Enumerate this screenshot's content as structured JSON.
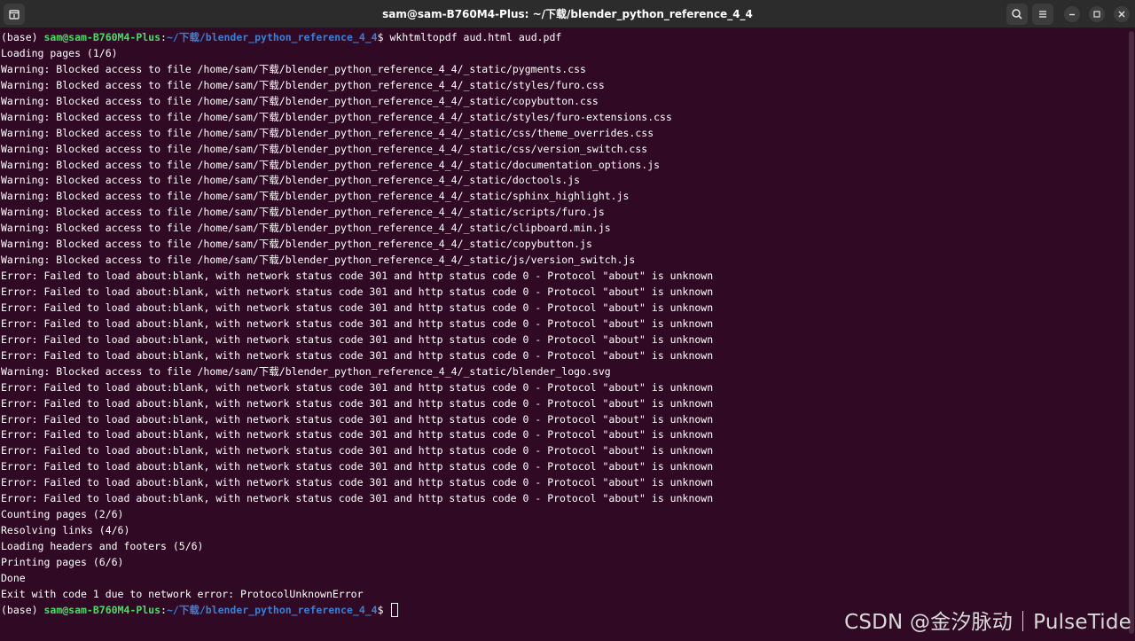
{
  "window": {
    "title": "sam@sam-B760M4-Plus: ~/下载/blender_python_reference_4_4",
    "icons": [
      "new-tab-icon",
      "search-icon",
      "menu-icon",
      "minimize-icon",
      "restore-icon",
      "close-icon"
    ]
  },
  "prompt": {
    "env": "(base) ",
    "user_host": "sam@sam-B760M4-Plus",
    "sep": ":",
    "path": "~/下载/blender_python_reference_4_4",
    "sign": "$ "
  },
  "command": "wkhtmltopdf aud.html aud.pdf",
  "output": [
    "Loading pages (1/6)",
    "Warning: Blocked access to file /home/sam/下载/blender_python_reference_4_4/_static/pygments.css",
    "Warning: Blocked access to file /home/sam/下载/blender_python_reference_4_4/_static/styles/furo.css",
    "Warning: Blocked access to file /home/sam/下载/blender_python_reference_4_4/_static/copybutton.css",
    "Warning: Blocked access to file /home/sam/下载/blender_python_reference_4_4/_static/styles/furo-extensions.css",
    "Warning: Blocked access to file /home/sam/下载/blender_python_reference_4_4/_static/css/theme_overrides.css",
    "Warning: Blocked access to file /home/sam/下载/blender_python_reference_4_4/_static/css/version_switch.css",
    "Warning: Blocked access to file /home/sam/下载/blender_python_reference_4_4/_static/documentation_options.js",
    "Warning: Blocked access to file /home/sam/下载/blender_python_reference_4_4/_static/doctools.js",
    "Warning: Blocked access to file /home/sam/下载/blender_python_reference_4_4/_static/sphinx_highlight.js",
    "Warning: Blocked access to file /home/sam/下载/blender_python_reference_4_4/_static/scripts/furo.js",
    "Warning: Blocked access to file /home/sam/下载/blender_python_reference_4_4/_static/clipboard.min.js",
    "Warning: Blocked access to file /home/sam/下载/blender_python_reference_4_4/_static/copybutton.js",
    "Warning: Blocked access to file /home/sam/下载/blender_python_reference_4_4/_static/js/version_switch.js",
    "Error: Failed to load about:blank, with network status code 301 and http status code 0 - Protocol \"about\" is unknown",
    "Error: Failed to load about:blank, with network status code 301 and http status code 0 - Protocol \"about\" is unknown",
    "Error: Failed to load about:blank, with network status code 301 and http status code 0 - Protocol \"about\" is unknown",
    "Error: Failed to load about:blank, with network status code 301 and http status code 0 - Protocol \"about\" is unknown",
    "Error: Failed to load about:blank, with network status code 301 and http status code 0 - Protocol \"about\" is unknown",
    "Error: Failed to load about:blank, with network status code 301 and http status code 0 - Protocol \"about\" is unknown",
    "Warning: Blocked access to file /home/sam/下载/blender_python_reference_4_4/_static/blender_logo.svg",
    "Error: Failed to load about:blank, with network status code 301 and http status code 0 - Protocol \"about\" is unknown",
    "Error: Failed to load about:blank, with network status code 301 and http status code 0 - Protocol \"about\" is unknown",
    "Error: Failed to load about:blank, with network status code 301 and http status code 0 - Protocol \"about\" is unknown",
    "Error: Failed to load about:blank, with network status code 301 and http status code 0 - Protocol \"about\" is unknown",
    "Error: Failed to load about:blank, with network status code 301 and http status code 0 - Protocol \"about\" is unknown",
    "Error: Failed to load about:blank, with network status code 301 and http status code 0 - Protocol \"about\" is unknown",
    "Error: Failed to load about:blank, with network status code 301 and http status code 0 - Protocol \"about\" is unknown",
    "Error: Failed to load about:blank, with network status code 301 and http status code 0 - Protocol \"about\" is unknown",
    "Counting pages (2/6)",
    "Resolving links (4/6)",
    "Loading headers and footers (5/6)",
    "Printing pages (6/6)",
    "Done",
    "Exit with code 1 due to network error: ProtocolUnknownError"
  ],
  "watermark": "CSDN @金汐脉动｜PulseTide",
  "colors": {
    "background": "#300a24",
    "titlebar": "#2c2c2c",
    "user_host": "#4fd86a",
    "path": "#3b7fd3",
    "text": "#ffffff"
  }
}
